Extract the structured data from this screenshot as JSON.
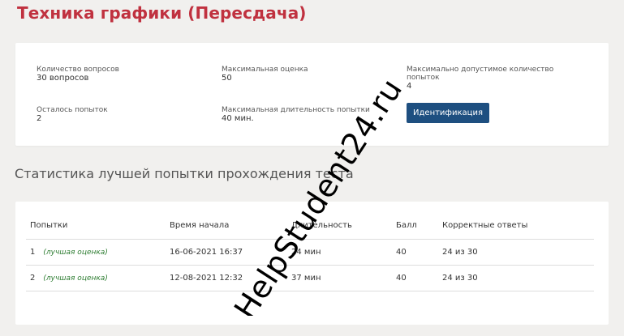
{
  "page": {
    "title": "Техника графики (Пересдача)"
  },
  "info": {
    "questions_label": "Количество вопросов",
    "questions_value": "30 вопросов",
    "max_score_label": "Максимальная оценка",
    "max_score_value": "50",
    "max_attempts_label": "Максимально допустимое количество попыток",
    "max_attempts_value": "4",
    "attempts_left_label": "Осталось попыток",
    "attempts_left_value": "2",
    "max_duration_label": "Максимальная длительность попытки",
    "max_duration_value": "40 мин.",
    "identify_button": "Идентификация"
  },
  "stats": {
    "heading": "Статистика лучшей попытки прохождения теста",
    "columns": [
      "Попытки",
      "Время начала",
      "Длительность",
      "Балл",
      "Корректные ответы"
    ],
    "rows": [
      {
        "num": "1",
        "tag": "(лучшая оценка)",
        "start": "16-06-2021 16:37",
        "duration": "24 мин",
        "score": "40",
        "correct": "24 из 30"
      },
      {
        "num": "2",
        "tag": "(лучшая оценка)",
        "start": "12-08-2021 12:32",
        "duration": "37 мин",
        "score": "40",
        "correct": "24 из 30"
      }
    ]
  },
  "watermark": "HelpStudent24.ru",
  "colors": {
    "title": "#c0313f",
    "button": "#1e4f80",
    "best_tag": "#2e7d32"
  }
}
